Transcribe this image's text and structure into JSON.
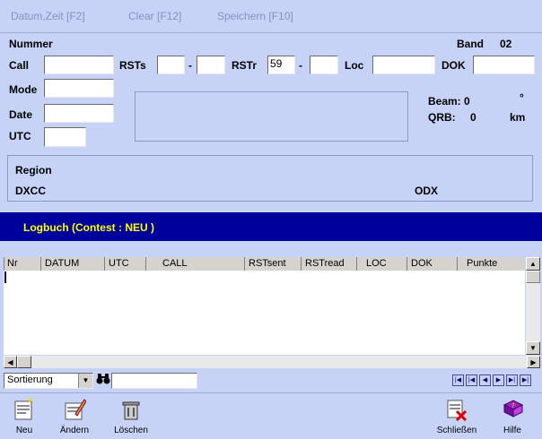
{
  "toolbar": {
    "datum_zeit": "Datum,Zeit [F2]",
    "clear": "Clear [F12]",
    "speichern": "Speichern [F10]"
  },
  "form": {
    "nummer_label": "Nummer",
    "band_label": "Band",
    "band_value": "02",
    "call_label": "Call",
    "rsts_label": "RSTs",
    "rsts_dash": "-",
    "rstr_label": "RSTr",
    "rstr_value": "59",
    "rstr_dash": "-",
    "loc_label": "Loc",
    "dok_label": "DOK",
    "mode_label": "Mode",
    "date_label": "Date",
    "utc_label": "UTC",
    "beam_label": "Beam: 0",
    "beam_unit": "°",
    "qrb_label": "QRB:",
    "qrb_value": "0",
    "qrb_unit": "km"
  },
  "region": {
    "region_label": "Region",
    "dxcc_label": "DXCC",
    "odx_label": "ODX"
  },
  "logbook": {
    "title": "Logbuch (Contest : NEU )",
    "columns": [
      "Nr",
      "DATUM",
      "UTC",
      "CALL",
      "RSTsent",
      "RSTread",
      "LOC",
      "DOK",
      "Punkte"
    ]
  },
  "sort": {
    "value": "Sortierung"
  },
  "bottom": {
    "neu": "Neu",
    "andern": "Ändern",
    "loschen": "Löschen",
    "schliessen": "Schließen",
    "hilfe": "Hilfe"
  },
  "colors": {
    "background": "#c6d3f7",
    "banner": "#00009c",
    "banner_text": "#ffff00"
  }
}
